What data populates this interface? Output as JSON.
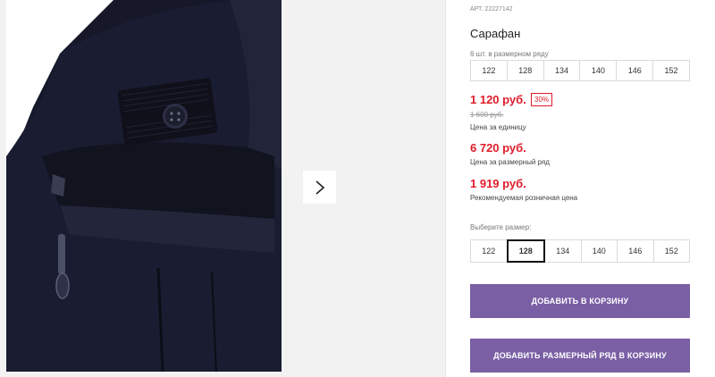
{
  "gallery": {
    "next_icon": "chevron-right-icon"
  },
  "product": {
    "sku_label": "АРТ.",
    "sku": "22227142",
    "title": "Сарафан",
    "pack_info": "6 шт. в размерном ряду",
    "pack_sizes": [
      "122",
      "128",
      "134",
      "140",
      "146",
      "152"
    ],
    "price": "1 120 руб.",
    "discount": "30%",
    "old_price": "1 600 руб.",
    "unit_caption": "Цена за единицу",
    "pack_price": "6 720 руб.",
    "pack_caption": "Цена за размерный ряд",
    "retail_price": "1 919 руб.",
    "retail_caption": "Рекомендуемая розничная цена",
    "choose_size_label": "Выберите размер:",
    "sizes": [
      "122",
      "128",
      "134",
      "140",
      "146",
      "152"
    ],
    "selected_size": "128",
    "add_to_cart": "ДОБАВИТЬ В КОРЗИНУ",
    "add_pack_to_cart": "ДОБАВИТЬ РАЗМЕРНЫЙ РЯД В КОРЗИНУ"
  },
  "colors": {
    "accent": "#7a5fa5",
    "price_red": "#e01b2a",
    "fabric": "#16182a"
  }
}
